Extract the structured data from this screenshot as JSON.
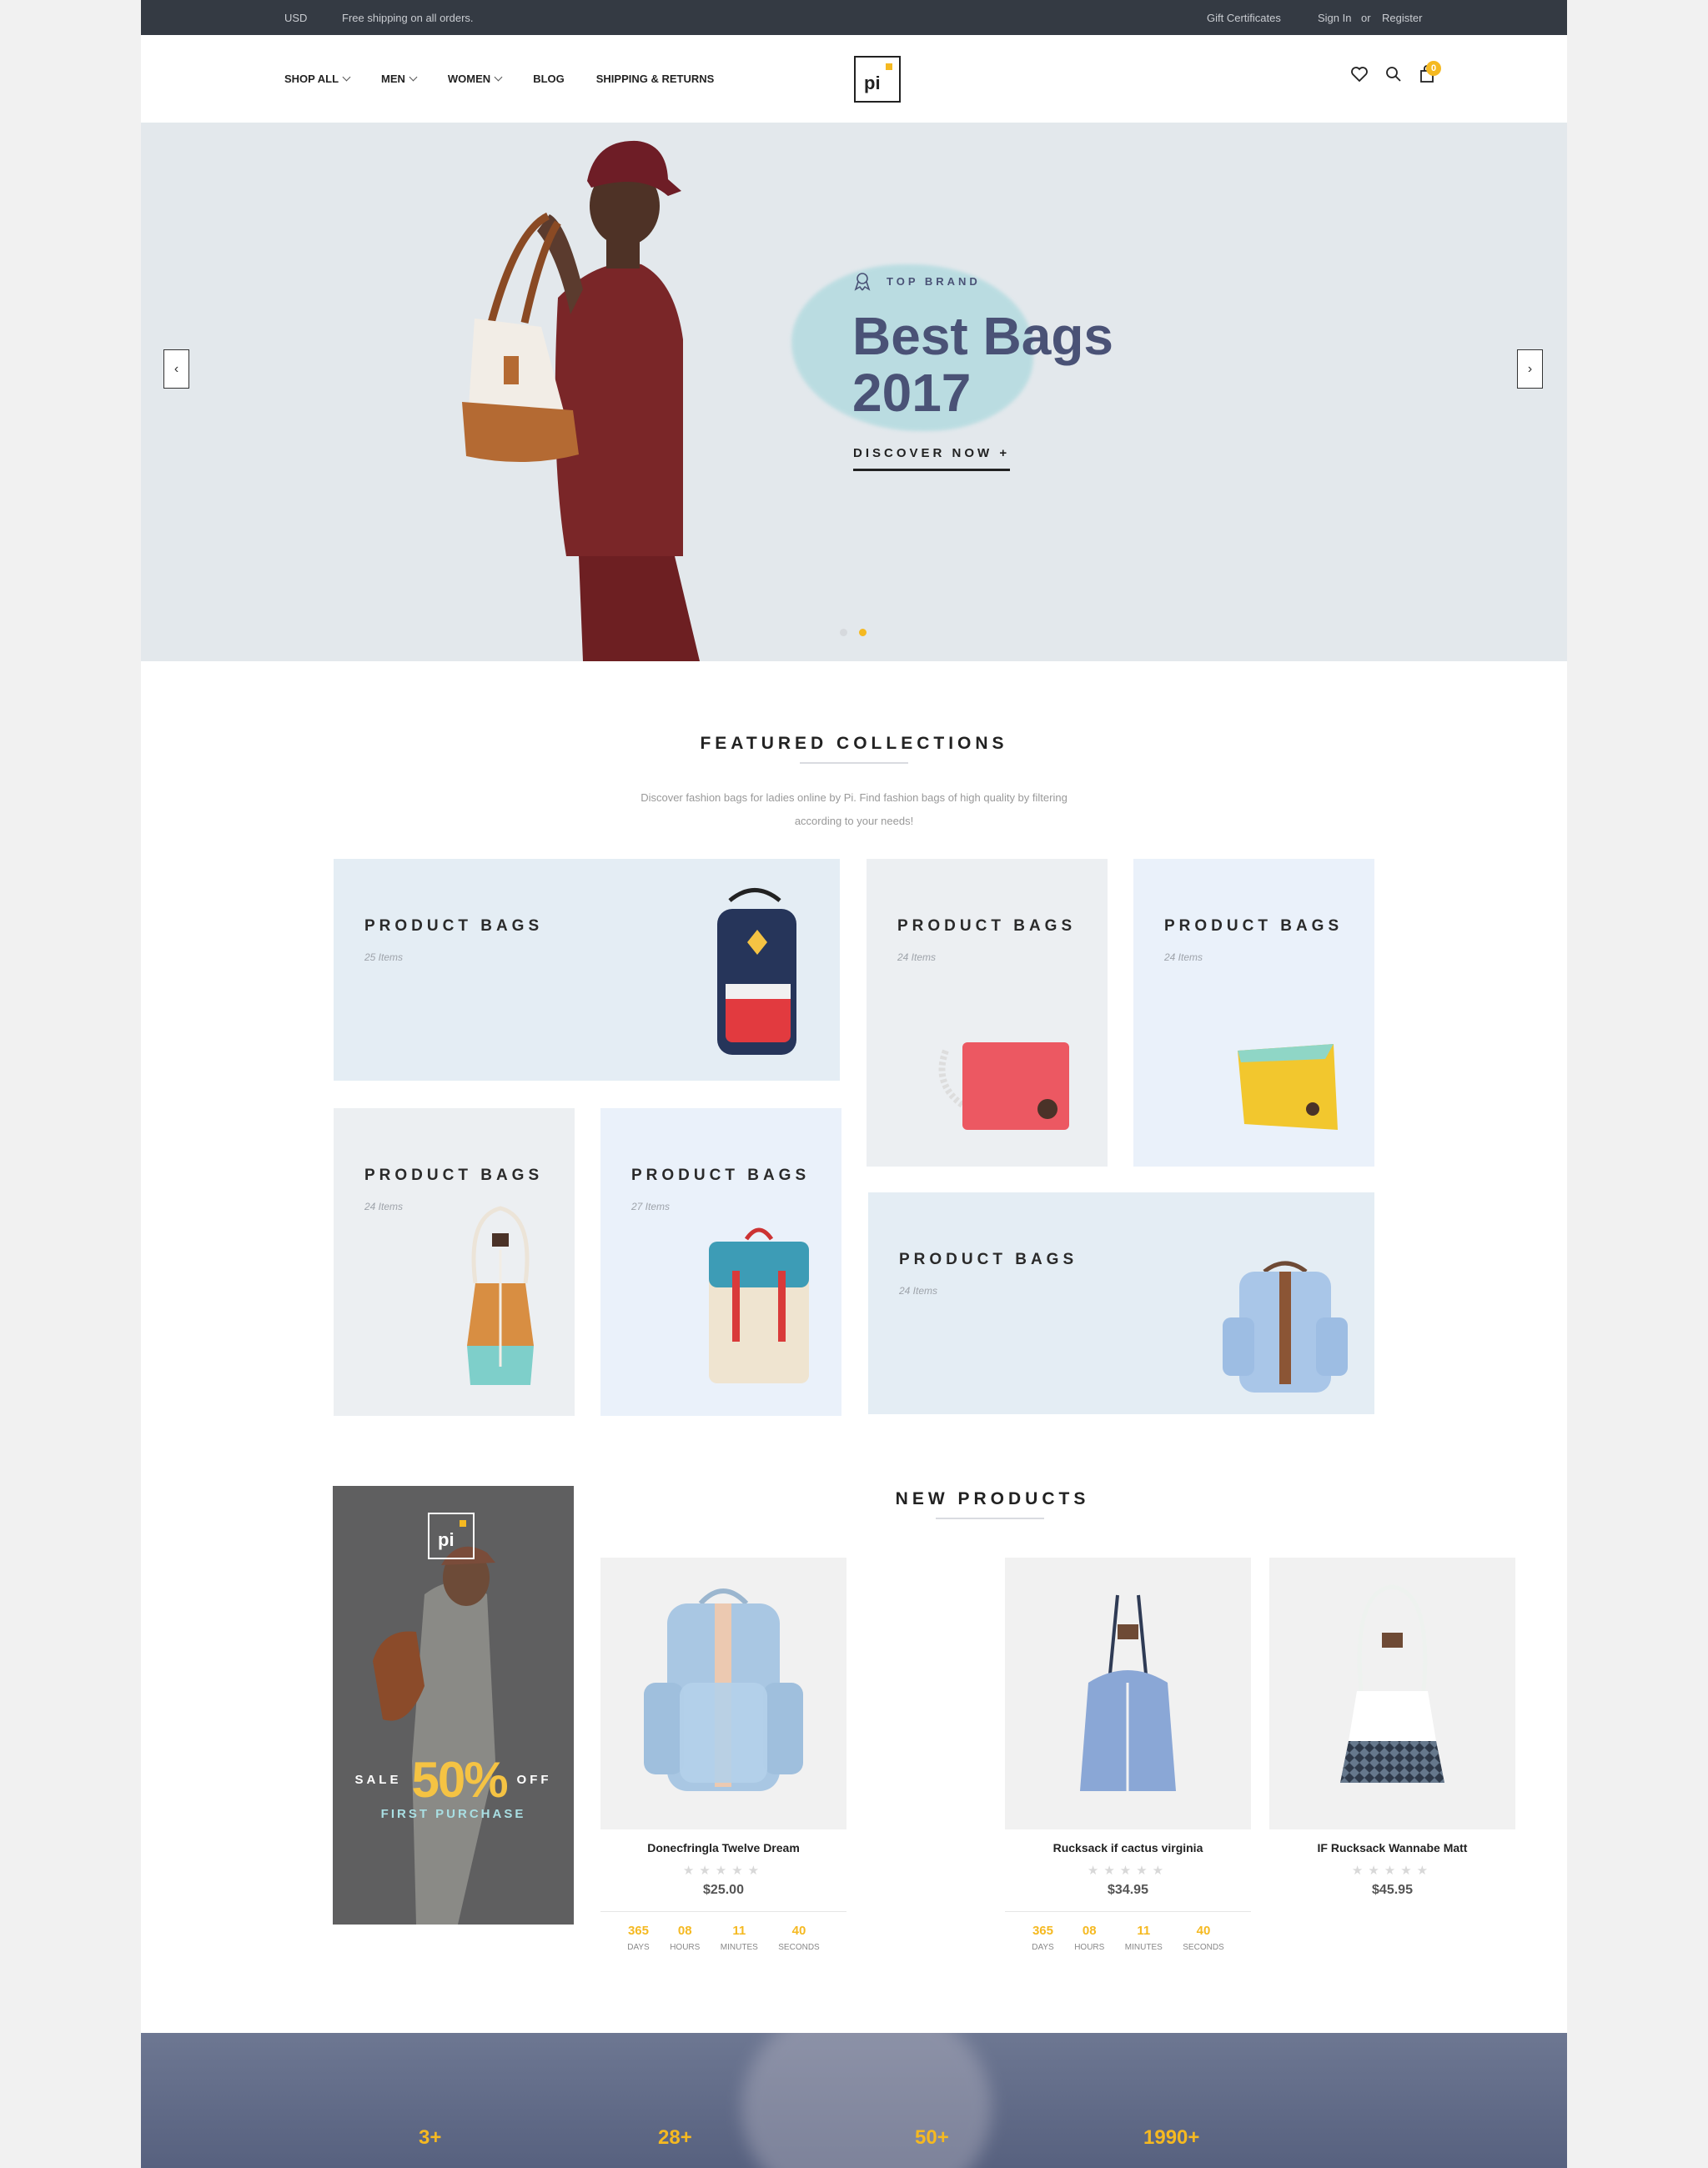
{
  "topbar": {
    "currency": "USD",
    "shipping_note": "Free shipping on all orders.",
    "gift": "Gift Certificates",
    "sign_in": "Sign In",
    "or": "or",
    "register": "Register"
  },
  "nav": {
    "items": [
      {
        "label": "SHOP ALL",
        "has_dropdown": true
      },
      {
        "label": "MEN",
        "has_dropdown": true
      },
      {
        "label": "WOMEN",
        "has_dropdown": true
      },
      {
        "label": "BLOG",
        "has_dropdown": false
      },
      {
        "label": "SHIPPING & RETURNS",
        "has_dropdown": false
      }
    ],
    "logo_text": "pi",
    "cart_count": "0",
    "icons": [
      "heart-icon",
      "search-icon",
      "cart-icon"
    ]
  },
  "hero": {
    "badge": "TOP BRAND",
    "title_line1": "Best Bags",
    "title_line2": "2017",
    "cta": "DISCOVER NOW +",
    "prev": "‹",
    "next": "›",
    "slides": 2,
    "active_slide": 2
  },
  "featured": {
    "title": "FEATURED COLLECTIONS",
    "desc_line1": "Discover fashion bags for ladies online by Pi. Find fashion bags of high quality by filtering",
    "desc_line2": "according to your needs!",
    "tiles": [
      {
        "name": "PRODUCT BAGS",
        "count": "25 Items"
      },
      {
        "name": "PRODUCT BAGS",
        "count": "24 Items"
      },
      {
        "name": "PRODUCT BAGS",
        "count": "24 Items"
      },
      {
        "name": "PRODUCT BAGS",
        "count": "24 Items"
      },
      {
        "name": "PRODUCT BAGS",
        "count": "27 Items"
      },
      {
        "name": "PRODUCT BAGS",
        "count": "24 Items"
      }
    ]
  },
  "promo": {
    "logo_text": "pi",
    "sale": "SALE",
    "percent": "50%",
    "off": "OFF",
    "first": "FIRST PURCHASE"
  },
  "new_products": {
    "title": "NEW PRODUCTS",
    "items": [
      {
        "name": "Donecfringla Twelve Dream",
        "price": "$25.00",
        "stars": "★★★★★"
      },
      {
        "name": "Rucksack if cactus virginia",
        "price": "$34.95",
        "stars": "★★★★★"
      },
      {
        "name": "IF Rucksack Wannabe Matt",
        "price": "$45.95",
        "stars": "★★★★★"
      }
    ],
    "countdown": [
      {
        "days": "365",
        "hours": "08",
        "minutes": "11",
        "seconds": "40"
      },
      {
        "days": "365",
        "hours": "08",
        "minutes": "11",
        "seconds": "40"
      }
    ],
    "labels": {
      "days": "DAYS",
      "hours": "HOURS",
      "minutes": "MINUTES",
      "seconds": "SECONDS"
    }
  },
  "stats": [
    "3+",
    "28+",
    "50+",
    "1990+"
  ],
  "colors": {
    "accent": "#f5b921",
    "topbar": "#343a43",
    "hero_title": "#4a5276"
  }
}
